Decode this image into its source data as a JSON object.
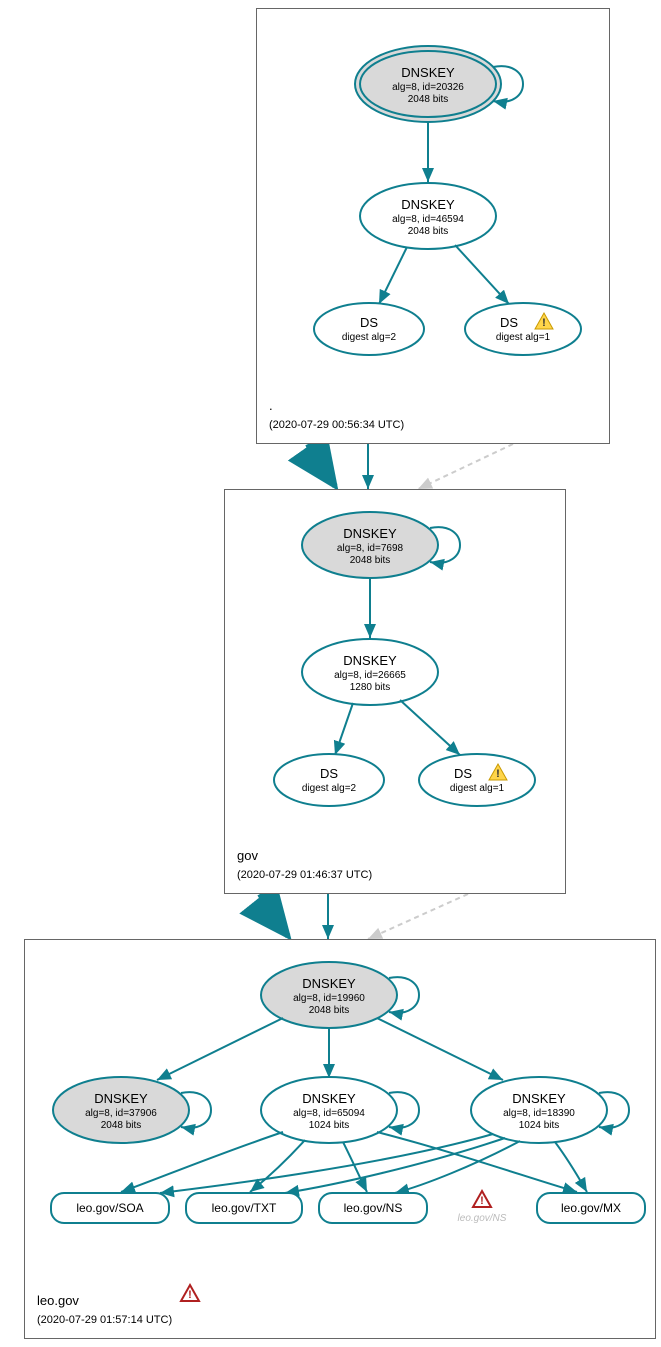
{
  "zones": {
    "root": {
      "name": ".",
      "time": "(2020-07-29 00:56:34 UTC)",
      "dnskey_top": {
        "title": "DNSKEY",
        "line1": "alg=8, id=20326",
        "line2": "2048 bits"
      },
      "dnskey_mid": {
        "title": "DNSKEY",
        "line1": "alg=8, id=46594",
        "line2": "2048 bits"
      },
      "ds_left": {
        "title": "DS",
        "line1": "digest alg=2"
      },
      "ds_right": {
        "title": "DS",
        "line1": "digest alg=1"
      }
    },
    "gov": {
      "name": "gov",
      "time": "(2020-07-29 01:46:37 UTC)",
      "dnskey_top": {
        "title": "DNSKEY",
        "line1": "alg=8, id=7698",
        "line2": "2048 bits"
      },
      "dnskey_mid": {
        "title": "DNSKEY",
        "line1": "alg=8, id=26665",
        "line2": "1280 bits"
      },
      "ds_left": {
        "title": "DS",
        "line1": "digest alg=2"
      },
      "ds_right": {
        "title": "DS",
        "line1": "digest alg=1"
      }
    },
    "leo": {
      "name": "leo.gov",
      "time": "(2020-07-29 01:57:14 UTC)",
      "dnskey_top": {
        "title": "DNSKEY",
        "line1": "alg=8, id=19960",
        "line2": "2048 bits"
      },
      "dnskey_l": {
        "title": "DNSKEY",
        "line1": "alg=8, id=37906",
        "line2": "2048 bits"
      },
      "dnskey_m": {
        "title": "DNSKEY",
        "line1": "alg=8, id=65094",
        "line2": "1024 bits"
      },
      "dnskey_r": {
        "title": "DNSKEY",
        "line1": "alg=8, id=18390",
        "line2": "1024 bits"
      },
      "rr_soa": "leo.gov/SOA",
      "rr_txt": "leo.gov/TXT",
      "rr_ns": "leo.gov/NS",
      "rr_ns_gray": "leo.gov/NS",
      "rr_mx": "leo.gov/MX"
    }
  },
  "colors": {
    "teal": "#0f7f8f",
    "gray_fill": "#d9d9d9",
    "light_edge": "#cccccc"
  }
}
